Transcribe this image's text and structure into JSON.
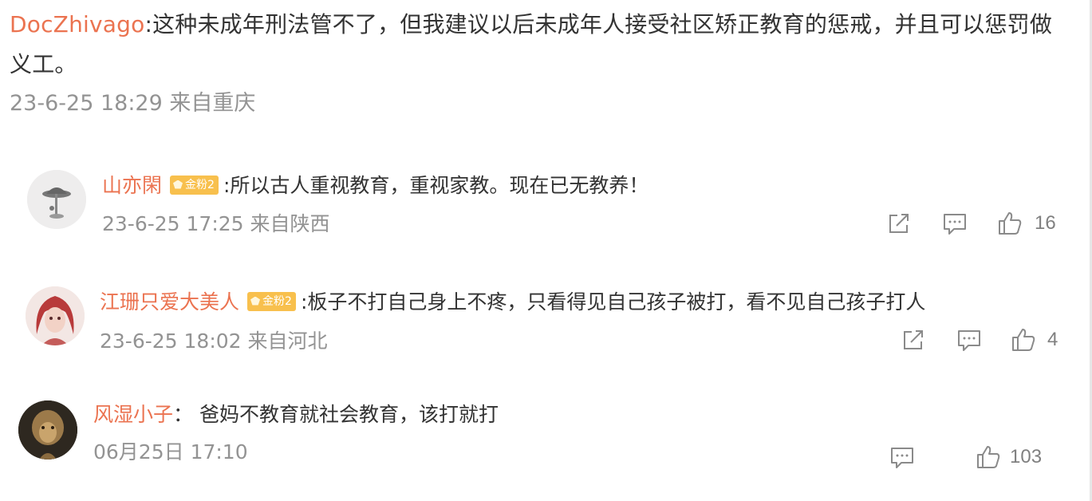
{
  "main_comment": {
    "username": "DocZhivago",
    "text": ":这种未成年刑法管不了，但我建议以后未成年人接受社区矫正教育的惩戒，并且可以惩罚做义工。",
    "meta": "23-6-25 18:29 来自重庆"
  },
  "replies": [
    {
      "username": "山亦閑",
      "badge": "金粉2",
      "text": ":所以古人重视教育，重视家教。现在已无教养！",
      "meta": "23-6-25 17:25 来自陕西",
      "likes": "16",
      "icons": [
        "share-icon",
        "comment-icon",
        "like-icon"
      ],
      "avatar_color": "#e8e6e6"
    },
    {
      "username": "江珊只爱大美人",
      "badge": "金粉2",
      "text": ":板子不打自己身上不疼，只看得见自己孩子被打，看不见自己孩子打人",
      "meta": "23-6-25 18:02 来自河北",
      "likes": "4",
      "icons": [
        "share-icon",
        "comment-icon",
        "like-icon"
      ],
      "avatar_color": "#c25a58"
    },
    {
      "username": "风湿小子",
      "text": "： 爸妈不教育就社会教育，该打就打",
      "meta": "06月25日 17:10",
      "likes": "103",
      "icons": [
        "comment-icon",
        "like-icon"
      ],
      "avatar_color": "#3c3428"
    }
  ],
  "colors": {
    "username": "#eb7350",
    "meta": "#939393",
    "text": "#333333",
    "badge": "#f8c04d",
    "icon": "#8a8a8a"
  }
}
